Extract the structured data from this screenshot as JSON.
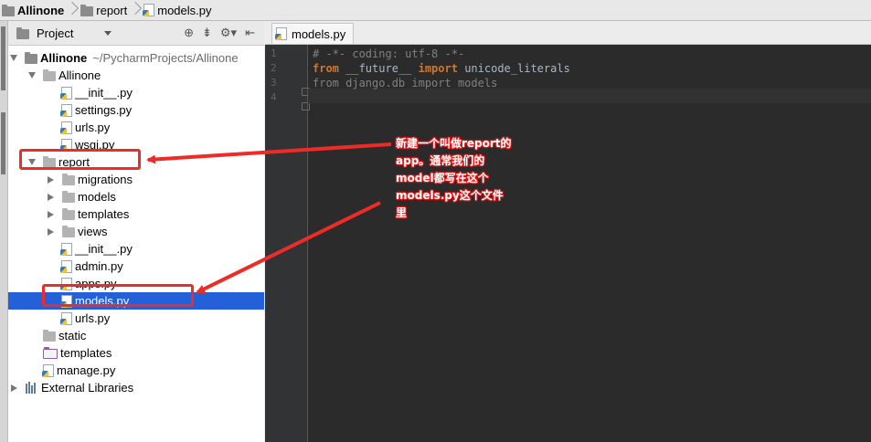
{
  "breadcrumb": {
    "items": [
      {
        "label": "Allinone",
        "icon": "folder-icon"
      },
      {
        "label": "report",
        "icon": "folder-icon"
      },
      {
        "label": "models.py",
        "icon": "python-file-icon"
      }
    ]
  },
  "project_panel": {
    "view_label": "Project",
    "header_icons": [
      "target-icon",
      "collapse-icon",
      "gear-icon",
      "hide-icon"
    ],
    "tree": [
      {
        "label": "Allinone",
        "path": "~/PycharmProjects/Allinone",
        "depth": 0,
        "type": "folder-root",
        "expanded": true
      },
      {
        "label": "Allinone",
        "depth": 1,
        "type": "folder",
        "expanded": true
      },
      {
        "label": "__init__.py",
        "depth": 2,
        "type": "py"
      },
      {
        "label": "settings.py",
        "depth": 2,
        "type": "py"
      },
      {
        "label": "urls.py",
        "depth": 2,
        "type": "py"
      },
      {
        "label": "wsgi.py",
        "depth": 2,
        "type": "py"
      },
      {
        "label": "report",
        "depth": 1,
        "type": "folder",
        "expanded": true
      },
      {
        "label": "migrations",
        "depth": 2,
        "type": "folder",
        "expanded": false
      },
      {
        "label": "models",
        "depth": 2,
        "type": "folder",
        "expanded": false
      },
      {
        "label": "templates",
        "depth": 2,
        "type": "folder",
        "expanded": false
      },
      {
        "label": "views",
        "depth": 2,
        "type": "folder",
        "expanded": false
      },
      {
        "label": "__init__.py",
        "depth": 2,
        "type": "py"
      },
      {
        "label": "admin.py",
        "depth": 2,
        "type": "py"
      },
      {
        "label": "apps.py",
        "depth": 2,
        "type": "py"
      },
      {
        "label": "models.py",
        "depth": 2,
        "type": "py",
        "selected": true
      },
      {
        "label": "urls.py",
        "depth": 2,
        "type": "py"
      },
      {
        "label": "static",
        "depth": 1,
        "type": "folder"
      },
      {
        "label": "templates",
        "depth": 1,
        "type": "folder-templates"
      },
      {
        "label": "manage.py",
        "depth": 1,
        "type": "py"
      },
      {
        "label": "External Libraries",
        "depth": 0,
        "type": "libraries",
        "expanded": false
      }
    ]
  },
  "editor": {
    "tab_label": "models.py",
    "line_numbers": [
      "1",
      "2",
      "3",
      "4"
    ],
    "lines": [
      {
        "parts": [
          {
            "t": "# -*- coding: utf-8 -*-",
            "c": "comment"
          }
        ]
      },
      {
        "parts": [
          {
            "t": "from",
            "c": "kw"
          },
          {
            "t": " __future__ ",
            "c": "name"
          },
          {
            "t": "import",
            "c": "kw"
          },
          {
            "t": " unicode_literals",
            "c": "name"
          }
        ]
      },
      {
        "parts": [
          {
            "t": "from django.db import models",
            "c": "faded"
          }
        ]
      },
      {
        "parts": []
      }
    ]
  },
  "annotation": {
    "lines": [
      "新建一个叫做report的",
      "app。通常我们的",
      "model都写在这个",
      "models.py这个文件",
      "里"
    ],
    "color": "#ee2b26"
  }
}
